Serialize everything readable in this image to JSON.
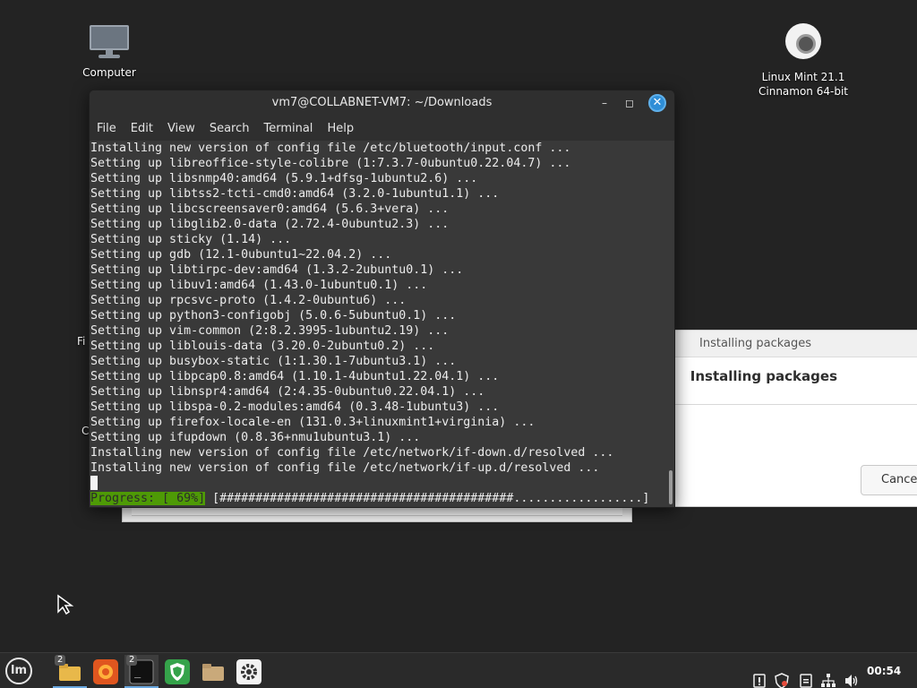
{
  "desktop": {
    "icons": [
      {
        "label": "Computer"
      },
      {
        "label_line1": "Linux Mint 21.1",
        "label_line2": "Cinnamon 64-bit"
      }
    ],
    "partial_labels": [
      "Fi",
      "C"
    ]
  },
  "terminal": {
    "title": "vm7@COLLABNET-VM7: ~/Downloads",
    "menu": [
      "File",
      "Edit",
      "View",
      "Search",
      "Terminal",
      "Help"
    ],
    "lines": [
      "Installing new version of config file /etc/bluetooth/input.conf ...",
      "Setting up libreoffice-style-colibre (1:7.3.7-0ubuntu0.22.04.7) ...",
      "Setting up libsnmp40:amd64 (5.9.1+dfsg-1ubuntu2.6) ...",
      "Setting up libtss2-tcti-cmd0:amd64 (3.2.0-1ubuntu1.1) ...",
      "Setting up libcscreensaver0:amd64 (5.6.3+vera) ...",
      "Setting up libglib2.0-data (2.72.4-0ubuntu2.3) ...",
      "Setting up sticky (1.14) ...",
      "Setting up gdb (12.1-0ubuntu1~22.04.2) ...",
      "Setting up libtirpc-dev:amd64 (1.3.2-2ubuntu0.1) ...",
      "Setting up libuv1:amd64 (1.43.0-1ubuntu0.1) ...",
      "Setting up rpcsvc-proto (1.4.2-0ubuntu6) ...",
      "Setting up python3-configobj (5.0.6-5ubuntu0.1) ...",
      "Setting up vim-common (2:8.2.3995-1ubuntu2.19) ...",
      "Setting up liblouis-data (3.20.0-2ubuntu0.2) ...",
      "Setting up busybox-static (1:1.30.1-7ubuntu3.1) ...",
      "Setting up libpcap0.8:amd64 (1.10.1-4ubuntu1.22.04.1) ...",
      "Setting up libnspr4:amd64 (2:4.35-0ubuntu0.22.04.1) ...",
      "Setting up libspa-0.2-modules:amd64 (0.3.48-1ubuntu3) ...",
      "Setting up firefox-locale-en (131.0.3+linuxmint1+virginia) ...",
      "Setting up ifupdown (0.8.36+nmu1ubuntu3.1) ...",
      "Installing new version of config file /etc/network/if-down.d/resolved ...",
      "Installing new version of config file /etc/network/if-up.d/resolved ..."
    ],
    "progress_label": "Progress: [ 69%]",
    "progress_bar": " [#########################################..................]",
    "progress_value": 0.69
  },
  "install_dialog": {
    "title": "Installing packages",
    "heading": "Installing packages",
    "cancel_label": "Cancel"
  },
  "taskbar": {
    "menu_icon": "mint-logo-icon",
    "items": [
      {
        "name": "files-icon",
        "badge": "2"
      },
      {
        "name": "firefox-icon"
      },
      {
        "name": "terminal-icon",
        "badge": "2"
      },
      {
        "name": "update-manager-icon"
      },
      {
        "name": "folder-icon"
      },
      {
        "name": "settings-icon"
      }
    ],
    "clock": "00:54"
  },
  "colors": {
    "desktop_bg": "#232323",
    "terminal_bg": "#393939",
    "progress_green": "#4e9a06",
    "accent_blue": "#2e8ed7"
  }
}
